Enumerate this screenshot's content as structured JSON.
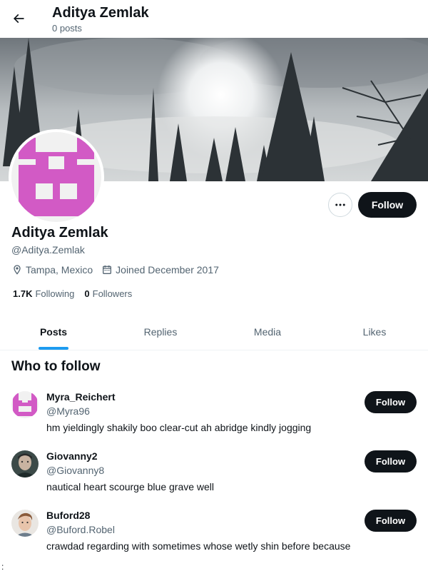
{
  "header": {
    "title": "Aditya Zemlak",
    "post_count": "0 posts",
    "back_icon": "arrow-left-icon"
  },
  "profile": {
    "name": "Aditya Zemlak",
    "handle": "@Aditya.Zemlak",
    "location": "Tampa, Mexico",
    "joined": "Joined December 2017",
    "following_count": "1.7K",
    "following_label": "Following",
    "followers_count": "0",
    "followers_label": "Followers",
    "follow_label": "Follow",
    "more_icon": "ellipsis-icon",
    "avatar_color": "#d25ac5"
  },
  "tabs": [
    {
      "label": "Posts",
      "active": true
    },
    {
      "label": "Replies",
      "active": false
    },
    {
      "label": "Media",
      "active": false
    },
    {
      "label": "Likes",
      "active": false
    }
  ],
  "who_to_follow": {
    "title": "Who to follow",
    "items": [
      {
        "name": "Myra_Reichert",
        "handle": "@Myra96",
        "bio": "hm yieldingly shakily boo clear-cut ah abridge kindly jogging",
        "follow_label": "Follow"
      },
      {
        "name": "Giovanny2",
        "handle": "@Giovanny8",
        "bio": "nautical heart scourge blue grave well",
        "follow_label": "Follow"
      },
      {
        "name": "Buford28",
        "handle": "@Buford.Robel",
        "bio": "crawdad regarding with sometimes whose wetly shin before because",
        "follow_label": "Follow"
      }
    ]
  },
  "colors": {
    "accent": "#1d9bf0",
    "button_dark": "#0f1419",
    "muted_text": "#536471"
  }
}
